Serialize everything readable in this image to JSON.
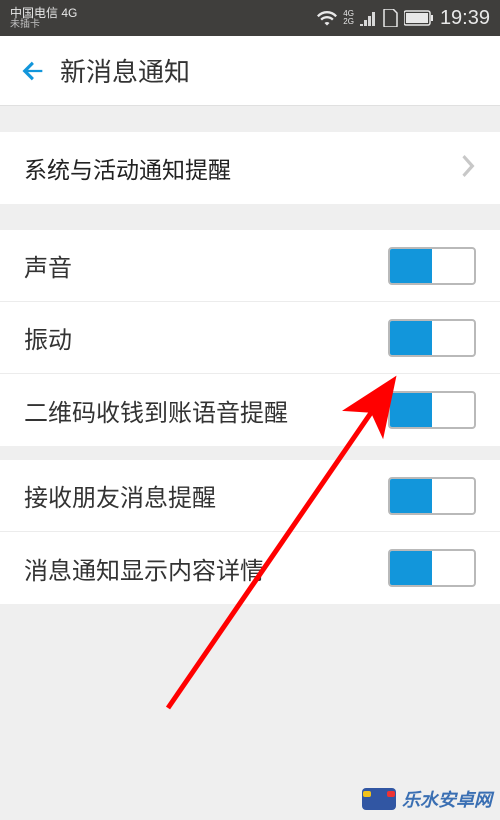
{
  "status_bar": {
    "carrier": "中国电信 4G",
    "sim_note": "未插卡",
    "net_top": "4G",
    "net_bot": "2G",
    "time": "19:39"
  },
  "header": {
    "title": "新消息通知"
  },
  "rows": {
    "system_notice": {
      "label": "系统与活动通知提醒"
    },
    "sound": {
      "label": "声音",
      "on": true
    },
    "vibrate": {
      "label": "振动",
      "on": true
    },
    "qr_voice": {
      "label": "二维码收钱到账语音提醒",
      "on": true
    },
    "friend_msg": {
      "label": "接收朋友消息提醒",
      "on": true
    },
    "show_detail": {
      "label": "消息通知显示内容详情",
      "on": true
    }
  },
  "watermark": {
    "text": "乐水安卓网"
  },
  "colors": {
    "accent": "#1296db",
    "status_bg": "#3f3e3c",
    "page_bg": "#efefef",
    "arrow": "#ff0000"
  }
}
